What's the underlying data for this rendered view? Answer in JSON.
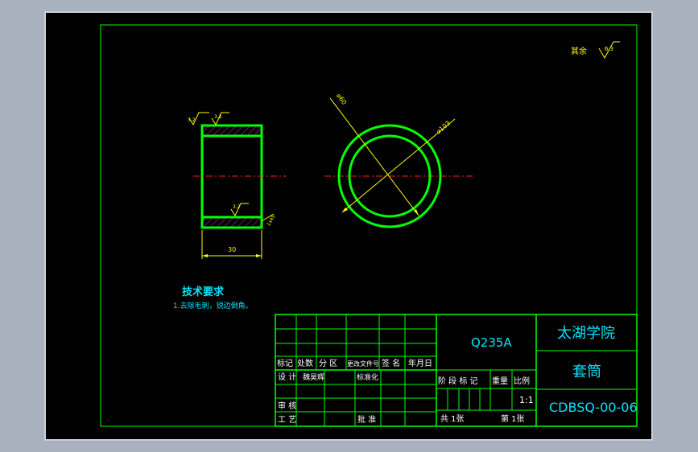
{
  "drawing": {
    "roughness_note": {
      "label": "其余",
      "value": "6.3"
    },
    "side_view": {
      "roughness_top_outer": "3.2",
      "roughness_top_left": "3.2",
      "roughness_inner": "3.2",
      "chamfer": "1x45",
      "width_dim": "30"
    },
    "front_view": {
      "inner_diameter": "⌀60",
      "outer_diameter": "⌀103"
    },
    "tech_requirements": {
      "title": "技术要求",
      "item1": "1.去除毛刺，锐边倒角。"
    }
  },
  "title_block": {
    "material": "Q235A",
    "school": "太湖学院",
    "part_name": "套筒",
    "drawing_no": "CDBSQ-00-06",
    "rev_headers": [
      "标记",
      "处数",
      "分 区",
      "更改文件号",
      "签 名",
      "年月日"
    ],
    "design_label": "设 计",
    "designer": "魏昊辉",
    "standardize_label": "标准化",
    "review_label": "审 核",
    "process_label": "工 艺",
    "approve_label": "批 准",
    "stage_label": "阶 段 标 记",
    "weight_label": "重量",
    "scale_label": "比例",
    "scale_value": "1:1",
    "total_sheets": "共 1张",
    "sheet_no": "第 1张"
  },
  "colors": {
    "background": "#000000",
    "outline": "#00ff00",
    "dimension": "#ffff00",
    "text": "#00e5ff",
    "centerline": "#ff2020"
  }
}
